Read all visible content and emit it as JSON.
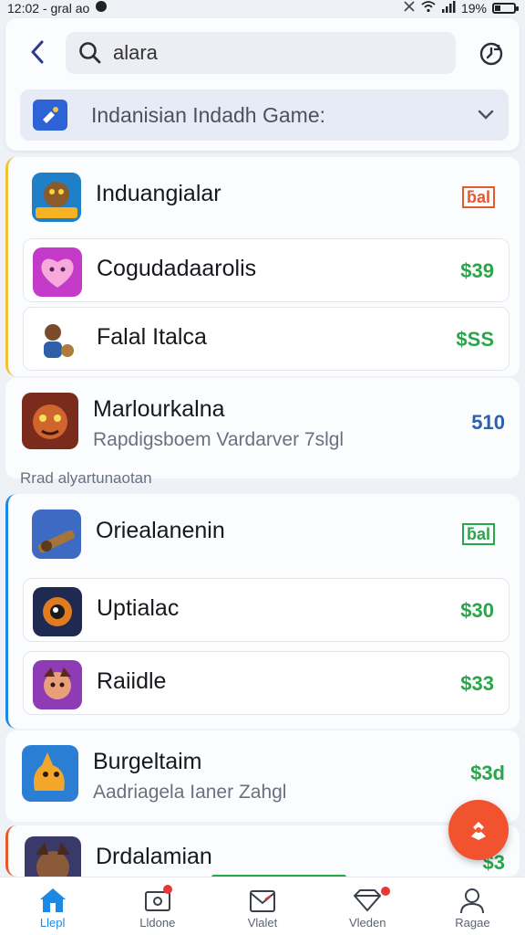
{
  "status_bar": {
    "time": "12:02 - gral ao",
    "battery": "19%"
  },
  "header": {
    "search_value": "alara",
    "category_label": "Indanisian Indadh Game:"
  },
  "group1": {
    "rows": [
      {
        "name": "Induangialar",
        "price": "ƃal"
      },
      {
        "name": "Cogudadaarolis",
        "price": "$39"
      },
      {
        "name": "Falal Italca",
        "price": "$SS"
      }
    ]
  },
  "card1": {
    "name": "Marlourkalna",
    "subtitle": "Rapdigsboem Vardarver 7slgl",
    "price": "510"
  },
  "section_label": "Rrad alyartunaotan",
  "group2": {
    "rows": [
      {
        "name": "Oriealanenin",
        "price": "ƃal"
      },
      {
        "name": "Uptialac",
        "price": "$30"
      },
      {
        "name": "Raiidle",
        "price": "$33"
      }
    ]
  },
  "card2": {
    "name": "Burgeltaim",
    "subtitle": "Aadriagela Ianer Zahgl",
    "price": "$3d"
  },
  "card3": {
    "name": "Drdalamian",
    "price": "$3"
  },
  "bottom_nav": {
    "items": [
      {
        "label": "Llepl"
      },
      {
        "label": "Lldone"
      },
      {
        "label": "Vlalet"
      },
      {
        "label": "Vleden"
      },
      {
        "label": "Ragae"
      }
    ]
  },
  "colors": {
    "accent": "#1e88e5",
    "price_green": "#29a64a",
    "price_red": "#e35a2e",
    "fab": "#f0532d"
  },
  "icons": [
    "back-arrow-icon",
    "search-icon",
    "history-icon",
    "category-icon",
    "chevron-down-icon",
    "fab-icon",
    "home-icon",
    "inbox-icon",
    "mail-icon",
    "gift-icon",
    "profile-icon"
  ]
}
